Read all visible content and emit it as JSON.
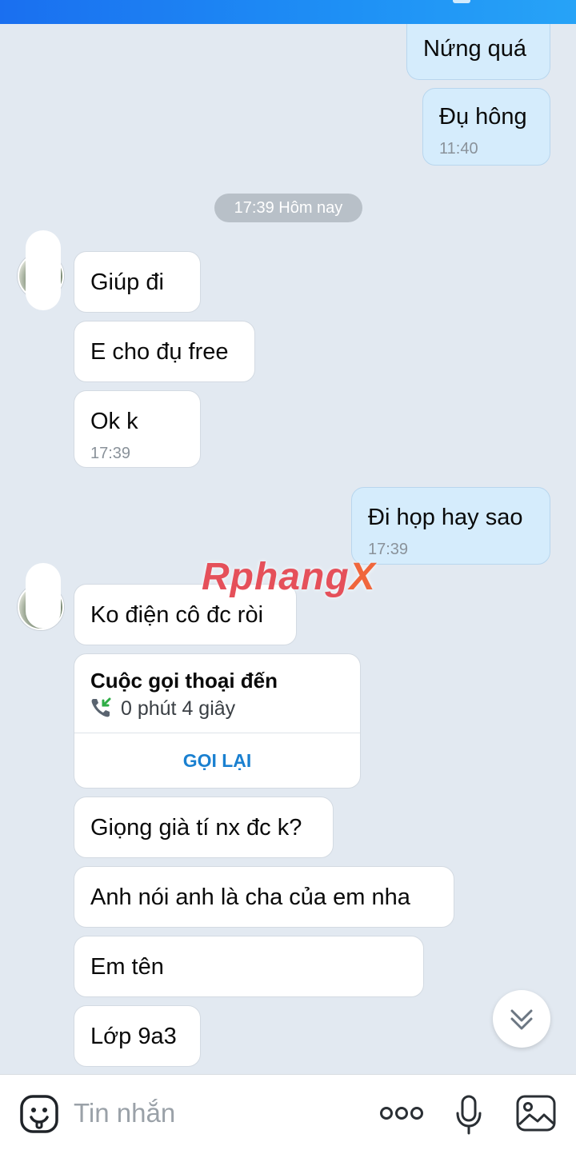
{
  "messages": {
    "m1": {
      "text": "Nứng quá"
    },
    "m2": {
      "text": "Đụ hông",
      "time": "11:40"
    },
    "date_divider": "17:39 Hôm nay",
    "m3": {
      "text": "Giúp đi"
    },
    "m4": {
      "text": "E cho đụ free"
    },
    "m5": {
      "text": "Ok k",
      "time": "17:39"
    },
    "m6": {
      "text": "Đi họp hay sao",
      "time": "17:39"
    },
    "m7": {
      "text": "Ko điện cô đc ròi"
    },
    "call": {
      "title": "Cuộc gọi thoại đến",
      "duration": "0 phút 4 giây",
      "action": "GỌI LẠI"
    },
    "m8": {
      "text": "Giọng già tí nx đc k?"
    },
    "m9": {
      "text": "Anh nói anh là cha của em nha"
    },
    "m10": {
      "text": "Em tên"
    },
    "m11": {
      "text": "Lớp 9a3"
    }
  },
  "watermark": {
    "main": "Rphang",
    "tail": "X"
  },
  "composer": {
    "placeholder": "Tin nhắn"
  },
  "icons": {
    "emoji": "emoji-icon",
    "more": "more-icon",
    "mic": "mic-icon",
    "photo": "photo-icon",
    "scroll": "chevron-double-down-icon",
    "call": "incoming-call-icon"
  },
  "colors": {
    "header": "#1e90f5",
    "background": "#e2e9f1",
    "outgoing_bubble": "#d5ecfc",
    "incoming_bubble": "#ffffff",
    "recall_link": "#1a80d0"
  }
}
